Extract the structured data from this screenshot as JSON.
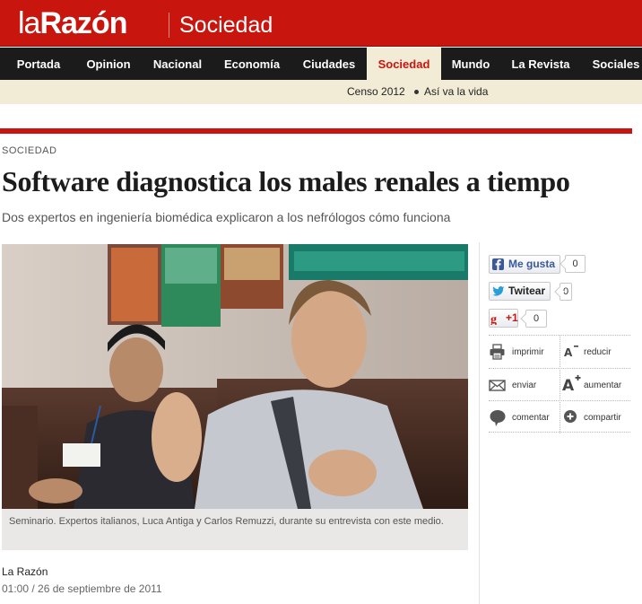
{
  "brand": {
    "logo_prefix": "la",
    "logo_main": "Razón",
    "section": "Sociedad",
    "color": "#c8150d"
  },
  "nav": {
    "items": [
      "Portada",
      "Opinion",
      "Nacional",
      "Economía",
      "Ciudades",
      "Sociedad",
      "Mundo",
      "La Revista",
      "Sociales"
    ],
    "active": "Sociedad"
  },
  "subnav": {
    "items": [
      "Censo 2012",
      "Así va la vida"
    ]
  },
  "article": {
    "kicker": "SOCIEDAD",
    "headline": "Software diagnostica los males renales a tiempo",
    "subhead": "Dos expertos en ingeniería biomédica explicaron a los nefrólogos cómo funciona",
    "photo_caption": "Seminario. Expertos italianos, Luca Antiga y Carlos Remuzzi, durante su entrevista con este medio.",
    "author": "La Razón",
    "time": "01:00",
    "date_sep": " / ",
    "date": "26 de septiembre de 2011"
  },
  "social": {
    "facebook": {
      "label": "Me gusta",
      "count": "0",
      "icon": "facebook-icon"
    },
    "twitter": {
      "label": "Twitear",
      "count": "0",
      "icon": "twitter-icon"
    },
    "gplus": {
      "label": "+1",
      "count": "0",
      "icon": "google-plus-icon"
    }
  },
  "tools": {
    "print": "imprimir",
    "reduce": "reducir",
    "send": "enviar",
    "increase": "aumentar",
    "comment": "comentar",
    "share": "compartir"
  }
}
